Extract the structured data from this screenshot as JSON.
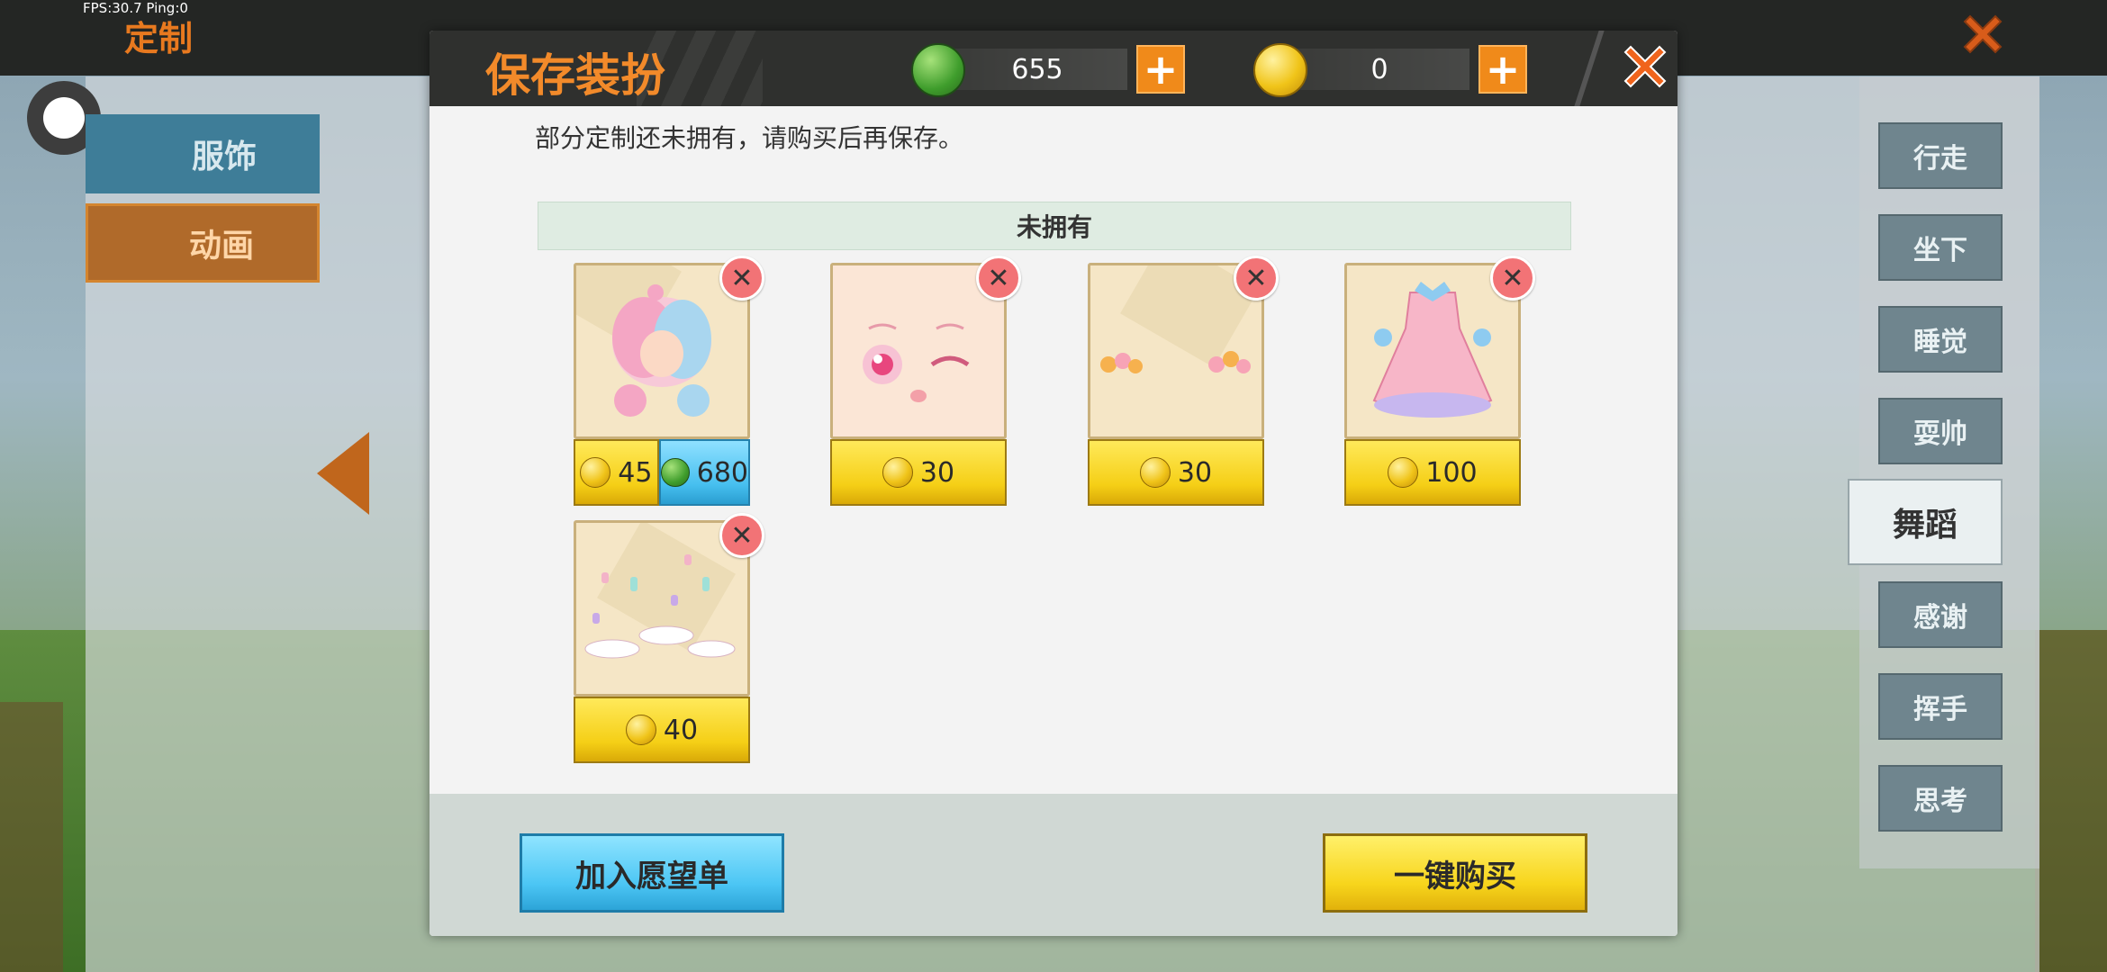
{
  "hud": {
    "fps_text": "FPS:30.7  Ping:0",
    "screen_title": "定制"
  },
  "left_tabs": [
    {
      "label": "服饰"
    },
    {
      "label": "动画"
    }
  ],
  "right_actions": [
    {
      "label": "行走"
    },
    {
      "label": "坐下"
    },
    {
      "label": "睡觉"
    },
    {
      "label": "耍帅"
    },
    {
      "label": "舞蹈",
      "selected": true
    },
    {
      "label": "感谢"
    },
    {
      "label": "挥手"
    },
    {
      "label": "思考"
    }
  ],
  "modal": {
    "title": "保存装扮",
    "currency": {
      "gems": "655",
      "coins": "0"
    },
    "notice": "部分定制还未拥有，请购买后再保存。",
    "section_title": "未拥有",
    "items": [
      {
        "name": "hair",
        "prices": [
          {
            "currency": "coin",
            "value": "45"
          },
          {
            "currency": "gem",
            "value": "680"
          }
        ]
      },
      {
        "name": "face",
        "prices": [
          {
            "currency": "coin",
            "value": "30"
          }
        ]
      },
      {
        "name": "accessory",
        "prices": [
          {
            "currency": "coin",
            "value": "30"
          }
        ]
      },
      {
        "name": "dress",
        "prices": [
          {
            "currency": "coin",
            "value": "100"
          }
        ]
      },
      {
        "name": "effect",
        "prices": [
          {
            "currency": "coin",
            "value": "40"
          }
        ]
      }
    ],
    "remove_glyph": "✕",
    "plus_glyph": "+",
    "buttons": {
      "wishlist": "加入愿望单",
      "buy_all": "一键购买"
    }
  },
  "colors": {
    "accent_orange": "#f28a2a",
    "gold": "#f5cf16",
    "sky_blue": "#46bfef"
  }
}
